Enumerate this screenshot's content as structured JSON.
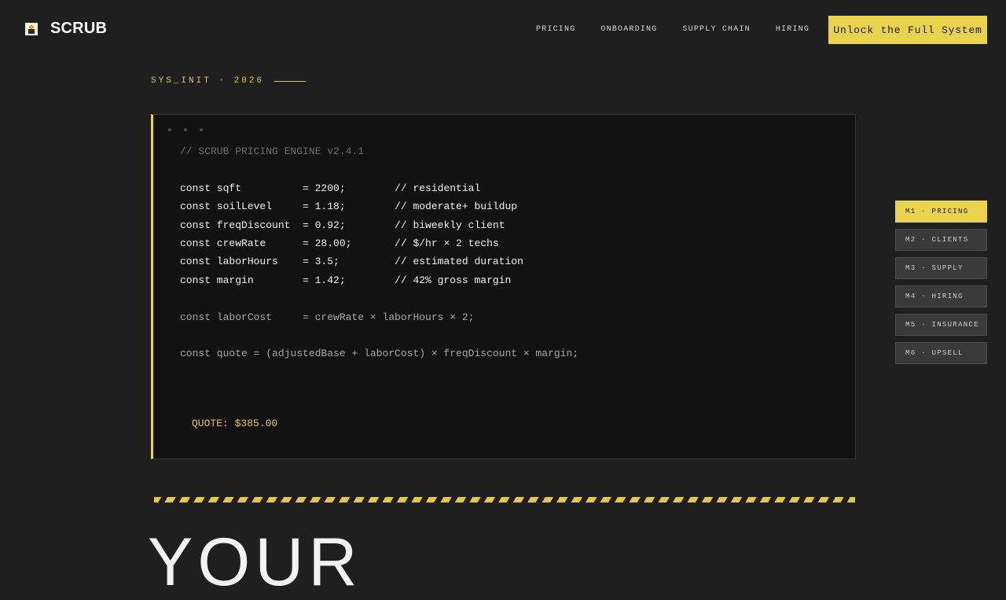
{
  "brand": {
    "name": "SCRUB",
    "icon": "scrub-logo-icon"
  },
  "nav": [
    "PRICING",
    "ONBOARDING",
    "SUPPLY CHAIN",
    "HIRING"
  ],
  "cta_label": "Unlock the Full System",
  "eyebrow": "SYS_INIT · 2026",
  "code": {
    "header": "// SCRUB PRICING ENGINE v2.4.1",
    "lines": [
      "const sqft          = 2200;        // residential",
      "const soilLevel     = 1.18;        // moderate+ buildup",
      "const freqDiscount  = 0.92;        // biweekly client",
      "const crewRate      = 28.00;       // $/hr × 2 techs",
      "const laborHours    = 3.5;         // estimated duration",
      "const margin        = 1.42;        // 42% gross margin"
    ],
    "labor_line": "const laborCost     = crewRate × laborHours × 2;",
    "quote_line": "const quote = (adjustedBase + laborCost) × freqDiscount × margin;",
    "result": "QUOTE: $385.00"
  },
  "modules": [
    "M1 · PRICING",
    "M2 · CLIENTS",
    "M3 · SUPPLY",
    "M4 · HIRING",
    "M5 · INSURANCE",
    "M6 · UPSELL"
  ],
  "headline": "YOUR",
  "colors": {
    "accent": "#e8d24e",
    "background": "#1f1f1f",
    "panel": "#121212"
  }
}
